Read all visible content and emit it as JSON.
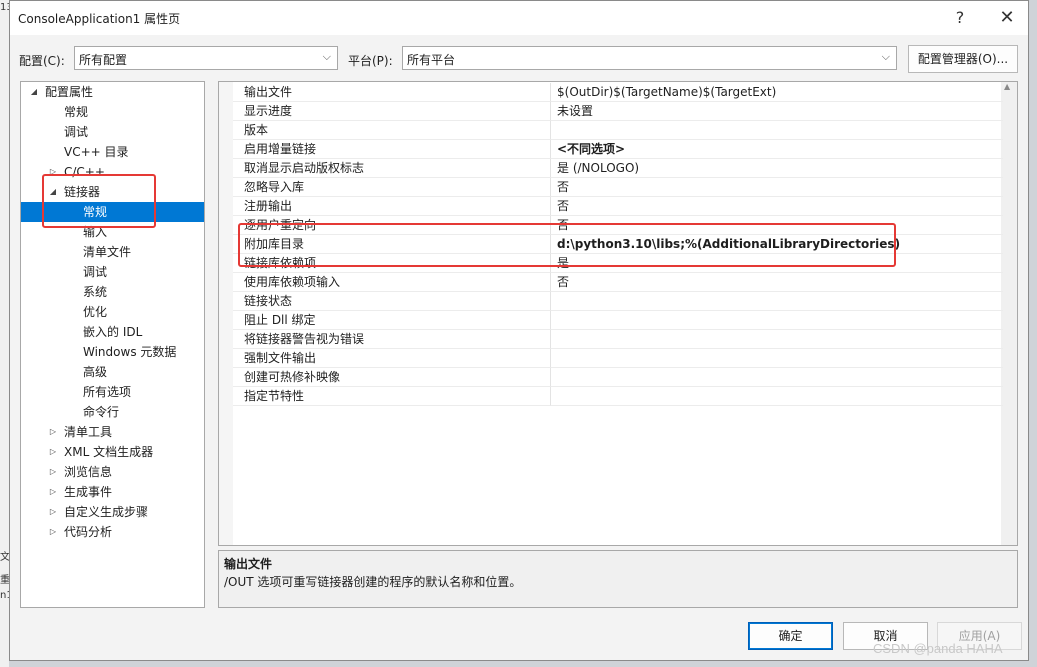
{
  "window": {
    "title": "ConsoleApplication1 属性页",
    "help": "?",
    "close": "✕"
  },
  "config": {
    "label": "配置(C):",
    "value": "所有配置"
  },
  "platform": {
    "label": "平台(P):",
    "value": "所有平台"
  },
  "config_manager": "配置管理器(O)...",
  "tree": [
    {
      "label": "配置属性",
      "exp": "◢"
    },
    {
      "label": "常规"
    },
    {
      "label": "调试"
    },
    {
      "label": "VC++ 目录"
    },
    {
      "label": "C/C++",
      "exp": "▷"
    },
    {
      "label": "链接器",
      "exp": "◢"
    },
    {
      "label": "常规",
      "selected": true
    },
    {
      "label": "输入"
    },
    {
      "label": "清单文件"
    },
    {
      "label": "调试"
    },
    {
      "label": "系统"
    },
    {
      "label": "优化"
    },
    {
      "label": "嵌入的 IDL"
    },
    {
      "label": "Windows 元数据"
    },
    {
      "label": "高级"
    },
    {
      "label": "所有选项"
    },
    {
      "label": "命令行"
    },
    {
      "label": "清单工具",
      "exp": "▷"
    },
    {
      "label": "XML 文档生成器",
      "exp": "▷"
    },
    {
      "label": "浏览信息",
      "exp": "▷"
    },
    {
      "label": "生成事件",
      "exp": "▷"
    },
    {
      "label": "自定义生成步骤",
      "exp": "▷"
    },
    {
      "label": "代码分析",
      "exp": "▷"
    }
  ],
  "properties": [
    {
      "name": "输出文件",
      "value": "$(OutDir)$(TargetName)$(TargetExt)"
    },
    {
      "name": "显示进度",
      "value": "未设置"
    },
    {
      "name": "版本",
      "value": ""
    },
    {
      "name": "启用增量链接",
      "value": "<不同选项>",
      "bold": true
    },
    {
      "name": "取消显示启动版权标志",
      "value": "是 (/NOLOGO)"
    },
    {
      "name": "忽略导入库",
      "value": "否"
    },
    {
      "name": "注册输出",
      "value": "否"
    },
    {
      "name": "逐用户重定向",
      "value": "否"
    },
    {
      "name": "附加库目录",
      "value": "d:\\python3.10\\libs;%(AdditionalLibraryDirectories)",
      "bold": true
    },
    {
      "name": "链接库依赖项",
      "value": "是"
    },
    {
      "name": "使用库依赖项输入",
      "value": "否"
    },
    {
      "name": "链接状态",
      "value": ""
    },
    {
      "name": "阻止 Dll 绑定",
      "value": ""
    },
    {
      "name": "将链接器警告视为错误",
      "value": ""
    },
    {
      "name": "强制文件输出",
      "value": ""
    },
    {
      "name": "创建可热修补映像",
      "value": ""
    },
    {
      "name": "指定节特性",
      "value": ""
    }
  ],
  "description": {
    "title": "输出文件",
    "text": "/OUT 选项可重写链接器创建的程序的默认名称和位置。"
  },
  "buttons": {
    "ok": "确定",
    "cancel": "取消",
    "apply": "应用(A)"
  },
  "watermark": "CSDN @panda HAHA",
  "background_fragments": [
    "13",
    "文",
    "重",
    "n1"
  ],
  "colors": {
    "selection": "#0078d4",
    "highlight_box": "#e53935"
  }
}
